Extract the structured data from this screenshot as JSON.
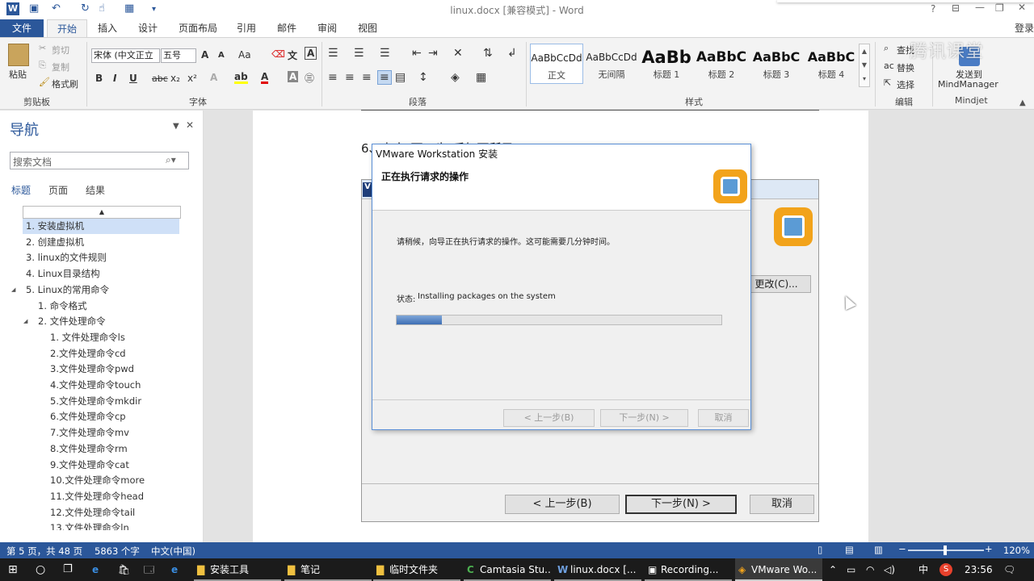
{
  "window": {
    "title": "linux.docx [兼容模式] - Word",
    "signin": "登录",
    "help": "?"
  },
  "tabs": [
    "文件",
    "开始",
    "插入",
    "设计",
    "页面布局",
    "引用",
    "邮件",
    "审阅",
    "视图"
  ],
  "ribbon": {
    "clipboard": {
      "paste": "粘贴",
      "cut": "剪切",
      "copy": "复制",
      "format_painter": "格式刷",
      "group": "剪贴板"
    },
    "font": {
      "name": "宋体 (中文正文)",
      "name_display": "宋体 (中文正立",
      "size": "五号",
      "group": "字体",
      "grow": "A",
      "case": "Aa",
      "bold": "B",
      "italic": "I",
      "underline": "U",
      "strike": "abc",
      "sub": "x₂",
      "sup": "x²"
    },
    "paragraph": {
      "group": "段落"
    },
    "styles": {
      "group": "样式",
      "items": [
        {
          "sample": "AaBbCcDd",
          "name": "正文"
        },
        {
          "sample": "AaBbCcDd",
          "name": "无间隔"
        },
        {
          "sample": "AaBb",
          "name": "标题 1"
        },
        {
          "sample": "AaBbC",
          "name": "标题 2"
        },
        {
          "sample": "AaBbC",
          "name": "标题 3"
        },
        {
          "sample": "AaBbC",
          "name": "标题 4"
        }
      ]
    },
    "editing": {
      "group": "编辑",
      "find": "查找",
      "replace": "替换",
      "select": "选择"
    },
    "mindjet": {
      "group": "Mindjet",
      "send": "发送到",
      "app": "MindManager"
    },
    "watermark": "腾讯课堂"
  },
  "nav": {
    "title": "导航",
    "search_placeholder": "搜索文档",
    "tabs": [
      "标题",
      "页面",
      "结果"
    ],
    "headings": [
      "1. 安装虚拟机",
      "2. 创建虚拟机",
      "3. linux的文件规则",
      "4. Linux目录结构",
      "5. Linux的常用命令",
      "1. 命令格式",
      "2. 文件处理命令",
      "1. 文件处理命令ls",
      "2.文件处理命令cd",
      "3.文件处理命令pwd",
      "4.文件处理命令touch",
      "5.文件处理命令mkdir",
      "6.文件处理命令cp",
      "7.文件处理命令mv",
      "8.文件处理命令rm",
      "9.文件处理命令cat",
      "10.文件处理命令more",
      "11.文件处理命令head",
      "12.文件处理命令tail",
      "13.文件处理命令ln"
    ]
  },
  "document": {
    "line": "6、点击\"下一步\"后如下所示"
  },
  "bg_dialog": {
    "change_button": "更改(C)...",
    "back": "< 上一步(B)",
    "next": "下一步(N) >",
    "cancel": "取消"
  },
  "installer": {
    "title": "VMware Workstation 安装",
    "heading": "正在执行请求的操作",
    "message": "请稍候，向导正在执行请求的操作。这可能需要几分钟时间。",
    "status_label": "状态:",
    "status_value": "Installing packages on the system",
    "progress": 0.14,
    "back": "< 上一步(B)",
    "next": "下一步(N) >",
    "cancel": "取消"
  },
  "statusbar": {
    "page": "第 5 页，共 48 页",
    "words": "5863 个字",
    "language": "中文(中国)",
    "zoom": "120%"
  },
  "taskbar": {
    "items": [
      "安装工具",
      "笔记",
      "临时文件夹",
      "Camtasia Stu...",
      "linux.docx [...",
      "Recording...",
      "VMware Wo..."
    ],
    "time": "23:56",
    "ime": "中"
  }
}
